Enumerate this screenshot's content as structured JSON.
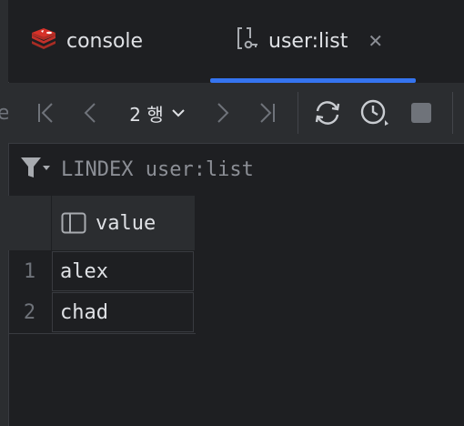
{
  "tabs": [
    {
      "label": "console",
      "icon": "redis-icon",
      "active": false
    },
    {
      "label": "user:list",
      "icon": "key-list-icon",
      "active": true
    }
  ],
  "toolbar": {
    "row_count": "2 행"
  },
  "filter": {
    "query": "LINDEX user:list"
  },
  "table": {
    "columns": [
      "value"
    ],
    "rows": [
      {
        "num": "1",
        "value": "alex"
      },
      {
        "num": "2",
        "value": "chad"
      }
    ]
  },
  "colors": {
    "accent": "#3574f0",
    "redis": "#d6322a",
    "background": "#1e1f22",
    "toolbar": "#2b2d30"
  }
}
